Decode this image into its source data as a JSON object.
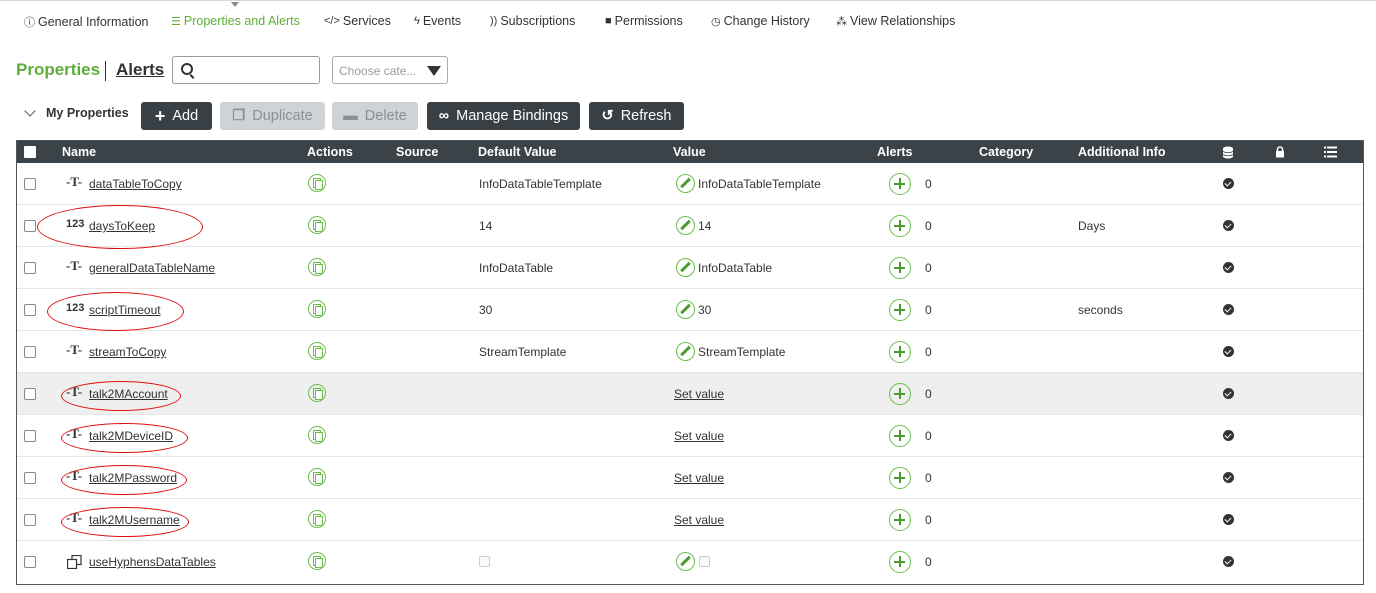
{
  "tabs": [
    {
      "label": "General Information",
      "icon": "info-icon"
    },
    {
      "label": "Properties and Alerts",
      "icon": "list-icon",
      "active": true
    },
    {
      "label": "Services",
      "icon": "code-icon"
    },
    {
      "label": "Events",
      "icon": "lightning-icon"
    },
    {
      "label": "Subscriptions",
      "icon": "rss-icon"
    },
    {
      "label": "Permissions",
      "icon": "lock-icon"
    },
    {
      "label": "Change History",
      "icon": "clock-icon"
    },
    {
      "label": "View Relationships",
      "icon": "hierarchy-icon"
    }
  ],
  "header": {
    "properties": "Properties",
    "alerts": "Alerts",
    "search_value": "",
    "category_placeholder": "Choose cate..."
  },
  "toolbar": {
    "section": "My Properties",
    "add": "Add",
    "duplicate": "Duplicate",
    "delete": "Delete",
    "manage_bindings": "Manage Bindings",
    "refresh": "Refresh"
  },
  "columns": {
    "name": "Name",
    "actions": "Actions",
    "source": "Source",
    "default_value": "Default Value",
    "value": "Value",
    "alerts": "Alerts",
    "category": "Category",
    "additional_info": "Additional Info"
  },
  "rows": [
    {
      "type": "T",
      "name": "dataTableToCopy",
      "default": "InfoDataTableTemplate",
      "value": "InfoDataTableTemplate",
      "alerts": "0",
      "info": ""
    },
    {
      "type": "123",
      "name": "daysToKeep",
      "default": "14",
      "value": "14",
      "alerts": "0",
      "info": "Days"
    },
    {
      "type": "T",
      "name": "generalDataTableName",
      "default": "InfoDataTable",
      "value": "InfoDataTable",
      "alerts": "0",
      "info": ""
    },
    {
      "type": "123",
      "name": "scriptTimeout",
      "default": "30",
      "value": "30",
      "alerts": "0",
      "info": "seconds"
    },
    {
      "type": "T",
      "name": "streamToCopy",
      "default": "StreamTemplate",
      "value": "StreamTemplate",
      "alerts": "0",
      "info": ""
    },
    {
      "type": "T",
      "name": "talk2MAccount",
      "default": "",
      "value": "Set value",
      "alerts": "0",
      "info": ""
    },
    {
      "type": "T",
      "name": "talk2MDeviceID",
      "default": "",
      "value": "Set value",
      "alerts": "0",
      "info": ""
    },
    {
      "type": "T",
      "name": "talk2MPassword",
      "default": "",
      "value": "Set value",
      "alerts": "0",
      "info": ""
    },
    {
      "type": "T",
      "name": "talk2MUsername",
      "default": "",
      "value": "Set value",
      "alerts": "0",
      "info": ""
    },
    {
      "type": "bool",
      "name": "useHyphensDataTables",
      "default": "",
      "value": "",
      "alerts": "0",
      "info": ""
    }
  ],
  "colors": {
    "accent": "#5fae3a",
    "header_bg": "#3b4348",
    "button_dark": "#383f45",
    "annotation": "#dd1111"
  }
}
